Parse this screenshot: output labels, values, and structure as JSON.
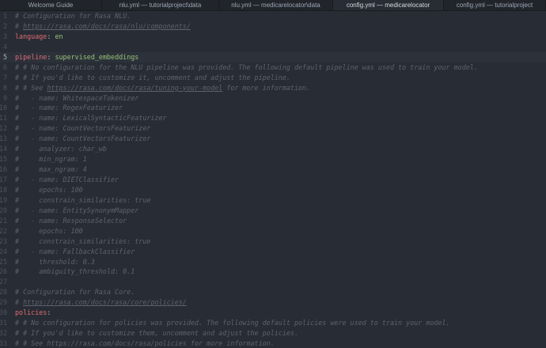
{
  "tabs": [
    {
      "label": "Welcome Guide",
      "active": false
    },
    {
      "label": "nlu.yml — tutorialproject\\data",
      "active": false
    },
    {
      "label": "nlu.yml — medicarelocator\\data",
      "active": false
    },
    {
      "label": "config.yml — medicarelocator",
      "active": true
    },
    {
      "label": "config.yml — tutorialproject",
      "active": false
    }
  ],
  "editor": {
    "cursor_line": 5,
    "lines": [
      {
        "num": "1",
        "parts": [
          {
            "t": "# Configuration for Rasa NLU.",
            "c": "cm"
          }
        ]
      },
      {
        "num": "2",
        "parts": [
          {
            "t": "# ",
            "c": "cm"
          },
          {
            "t": "https://rasa.com/docs/rasa/nlu/components/",
            "c": "cm url"
          }
        ]
      },
      {
        "num": "3",
        "parts": [
          {
            "t": "language",
            "c": "key"
          },
          {
            "t": ": ",
            "c": "plain"
          },
          {
            "t": "en",
            "c": "val"
          }
        ]
      },
      {
        "num": "4",
        "parts": []
      },
      {
        "num": "5",
        "parts": [
          {
            "t": "pipeline",
            "c": "key"
          },
          {
            "t": ": ",
            "c": "plain"
          },
          {
            "t": "supervised_embeddings",
            "c": "val"
          }
        ]
      },
      {
        "num": "6",
        "parts": [
          {
            "t": "# # No configuration for the NLU pipeline was provided. The following default pipeline was used to train your model.",
            "c": "cm"
          }
        ]
      },
      {
        "num": "7",
        "parts": [
          {
            "t": "# # If you'd like to customize it, uncomment and adjust the pipeline.",
            "c": "cm"
          }
        ]
      },
      {
        "num": "8",
        "parts": [
          {
            "t": "# # See ",
            "c": "cm"
          },
          {
            "t": "https://rasa.com/docs/rasa/tuning-your-model",
            "c": "cm url"
          },
          {
            "t": " for more information.",
            "c": "cm"
          }
        ]
      },
      {
        "num": "9",
        "parts": [
          {
            "t": "#   - name: WhitespaceTokenizer",
            "c": "cm"
          }
        ]
      },
      {
        "num": "10",
        "parts": [
          {
            "t": "#   - name: RegexFeaturizer",
            "c": "cm"
          }
        ]
      },
      {
        "num": "11",
        "parts": [
          {
            "t": "#   - name: LexicalSyntacticFeaturizer",
            "c": "cm"
          }
        ]
      },
      {
        "num": "12",
        "parts": [
          {
            "t": "#   - name: CountVectorsFeaturizer",
            "c": "cm"
          }
        ]
      },
      {
        "num": "13",
        "parts": [
          {
            "t": "#   - name: CountVectorsFeaturizer",
            "c": "cm"
          }
        ]
      },
      {
        "num": "14",
        "parts": [
          {
            "t": "#     analyzer: char_wb",
            "c": "cm"
          }
        ]
      },
      {
        "num": "15",
        "parts": [
          {
            "t": "#     min_ngram: 1",
            "c": "cm"
          }
        ]
      },
      {
        "num": "16",
        "parts": [
          {
            "t": "#     max_ngram: 4",
            "c": "cm"
          }
        ]
      },
      {
        "num": "17",
        "parts": [
          {
            "t": "#   - name: DIETClassifier",
            "c": "cm"
          }
        ]
      },
      {
        "num": "18",
        "parts": [
          {
            "t": "#     epochs: 100",
            "c": "cm"
          }
        ]
      },
      {
        "num": "19",
        "parts": [
          {
            "t": "#     constrain_similarities: true",
            "c": "cm"
          }
        ]
      },
      {
        "num": "20",
        "parts": [
          {
            "t": "#   - name: EntitySynonymMapper",
            "c": "cm"
          }
        ]
      },
      {
        "num": "21",
        "parts": [
          {
            "t": "#   - name: ResponseSelector",
            "c": "cm"
          }
        ]
      },
      {
        "num": "22",
        "parts": [
          {
            "t": "#     epochs: 100",
            "c": "cm"
          }
        ]
      },
      {
        "num": "23",
        "parts": [
          {
            "t": "#     constrain_similarities: true",
            "c": "cm"
          }
        ]
      },
      {
        "num": "24",
        "parts": [
          {
            "t": "#   - name: FallbackClassifier",
            "c": "cm"
          }
        ]
      },
      {
        "num": "25",
        "parts": [
          {
            "t": "#     threshold: 0.3",
            "c": "cm"
          }
        ]
      },
      {
        "num": "26",
        "parts": [
          {
            "t": "#     ambiguity_threshold: 0.1",
            "c": "cm"
          }
        ]
      },
      {
        "num": "27",
        "parts": []
      },
      {
        "num": "28",
        "parts": [
          {
            "t": "# Configuration for Rasa Core.",
            "c": "cm"
          }
        ]
      },
      {
        "num": "29",
        "parts": [
          {
            "t": "# ",
            "c": "cm"
          },
          {
            "t": "https://rasa.com/docs/rasa/core/policies/",
            "c": "cm url"
          }
        ]
      },
      {
        "num": "30",
        "parts": [
          {
            "t": "policies",
            "c": "key"
          },
          {
            "t": ":",
            "c": "plain"
          }
        ]
      },
      {
        "num": "31",
        "parts": [
          {
            "t": "# # No configuration for policies was provided. The following default policies were used to train your model.",
            "c": "cm"
          }
        ]
      },
      {
        "num": "32",
        "parts": [
          {
            "t": "# # If you'd like to customize them, uncomment and adjust the policies.",
            "c": "cm"
          }
        ]
      },
      {
        "num": "33",
        "parts": [
          {
            "t": "# # See https://rasa.com/docs/rasa/policies for more information.",
            "c": "cm"
          }
        ]
      }
    ]
  }
}
